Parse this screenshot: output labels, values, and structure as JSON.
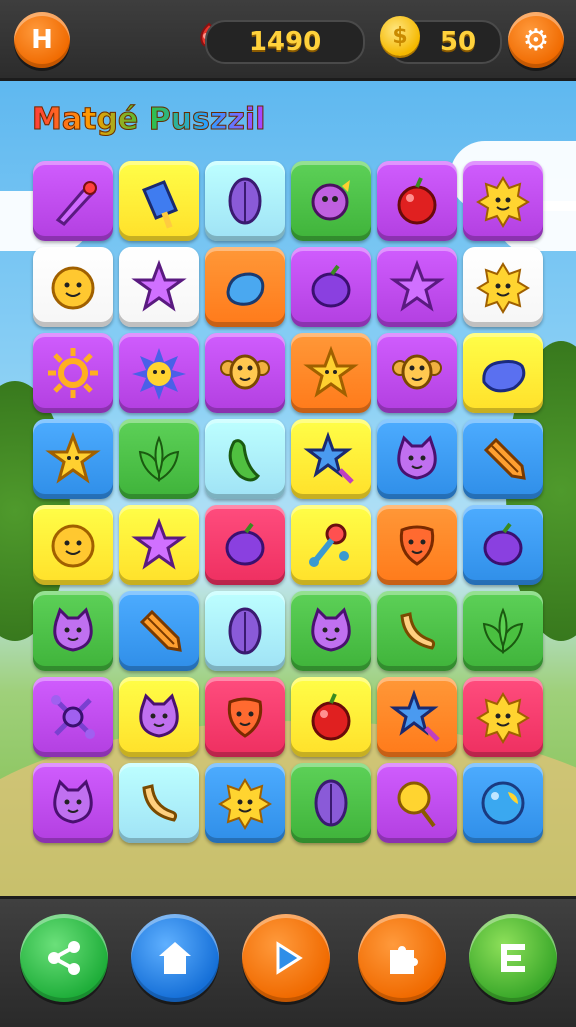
{
  "header": {
    "home_glyph": "H",
    "score": "1490",
    "coins": "50",
    "coin_glyph": "$"
  },
  "title": "Matgé Puszzil",
  "colors": {
    "purple": "#b23fe0",
    "yellow": "#ffe02a",
    "lightblue": "#9fe2f5",
    "green": "#3fb33a",
    "orange": "#ff7a1a",
    "red": "#ee2f60",
    "white": "#f6f6f6",
    "blue": "#2f8ee8"
  },
  "grid": [
    [
      {
        "bg": "purple",
        "icon": "brush-icon"
      },
      {
        "bg": "yellow",
        "icon": "popsicle-icon"
      },
      {
        "bg": "lightblue",
        "icon": "leaf-icon"
      },
      {
        "bg": "green",
        "icon": "monster-icon"
      },
      {
        "bg": "purple",
        "icon": "apple-icon"
      },
      {
        "bg": "purple",
        "icon": "sun-face-icon"
      }
    ],
    [
      {
        "bg": "white",
        "icon": "smiley-icon"
      },
      {
        "bg": "white",
        "icon": "star-icon"
      },
      {
        "bg": "orange",
        "icon": "fruit-icon"
      },
      {
        "bg": "purple",
        "icon": "plum-icon"
      },
      {
        "bg": "purple",
        "icon": "star-icon"
      },
      {
        "bg": "white",
        "icon": "sun-face-icon"
      }
    ],
    [
      {
        "bg": "purple",
        "icon": "sun-icon"
      },
      {
        "bg": "purple",
        "icon": "flower-icon"
      },
      {
        "bg": "purple",
        "icon": "monkey-icon"
      },
      {
        "bg": "orange",
        "icon": "star-face-icon"
      },
      {
        "bg": "purple",
        "icon": "monkey-icon"
      },
      {
        "bg": "yellow",
        "icon": "jelly-icon"
      }
    ],
    [
      {
        "bg": "blue",
        "icon": "star-face-icon"
      },
      {
        "bg": "green",
        "icon": "leaves-icon"
      },
      {
        "bg": "lightblue",
        "icon": "bean-icon"
      },
      {
        "bg": "yellow",
        "icon": "star-wand-icon"
      },
      {
        "bg": "blue",
        "icon": "cat-face-icon"
      },
      {
        "bg": "blue",
        "icon": "crayon-icon"
      }
    ],
    [
      {
        "bg": "yellow",
        "icon": "smiley-icon"
      },
      {
        "bg": "yellow",
        "icon": "star-icon"
      },
      {
        "bg": "red",
        "icon": "plum-icon"
      },
      {
        "bg": "yellow",
        "icon": "rattle-icon"
      },
      {
        "bg": "orange",
        "icon": "mask-icon"
      },
      {
        "bg": "blue",
        "icon": "plum-icon"
      }
    ],
    [
      {
        "bg": "green",
        "icon": "cat-face-icon"
      },
      {
        "bg": "blue",
        "icon": "crayon-icon"
      },
      {
        "bg": "lightblue",
        "icon": "leaf-icon"
      },
      {
        "bg": "green",
        "icon": "cat-face-icon"
      },
      {
        "bg": "green",
        "icon": "banana-icon"
      },
      {
        "bg": "green",
        "icon": "leaves-icon"
      }
    ],
    [
      {
        "bg": "purple",
        "icon": "molecule-icon"
      },
      {
        "bg": "yellow",
        "icon": "cat-face-icon"
      },
      {
        "bg": "red",
        "icon": "mask-icon"
      },
      {
        "bg": "yellow",
        "icon": "apple-icon"
      },
      {
        "bg": "orange",
        "icon": "star-wand-icon"
      },
      {
        "bg": "red",
        "icon": "sun-face-icon"
      }
    ],
    [
      {
        "bg": "purple",
        "icon": "cat-face-icon"
      },
      {
        "bg": "lightblue",
        "icon": "banana-icon"
      },
      {
        "bg": "blue",
        "icon": "sun-face-icon"
      },
      {
        "bg": "green",
        "icon": "leaf-icon"
      },
      {
        "bg": "purple",
        "icon": "balloon-icon"
      },
      {
        "bg": "blue",
        "icon": "bubble-icon"
      }
    ]
  ],
  "footer": {
    "buttons": [
      {
        "name": "share-button",
        "icon": "share-icon"
      },
      {
        "name": "home-button",
        "icon": "house-icon"
      },
      {
        "name": "play-button",
        "icon": "play-icon"
      },
      {
        "name": "hint-button",
        "icon": "puzzle-icon"
      },
      {
        "name": "menu-button",
        "icon": "menu-icon"
      }
    ]
  }
}
